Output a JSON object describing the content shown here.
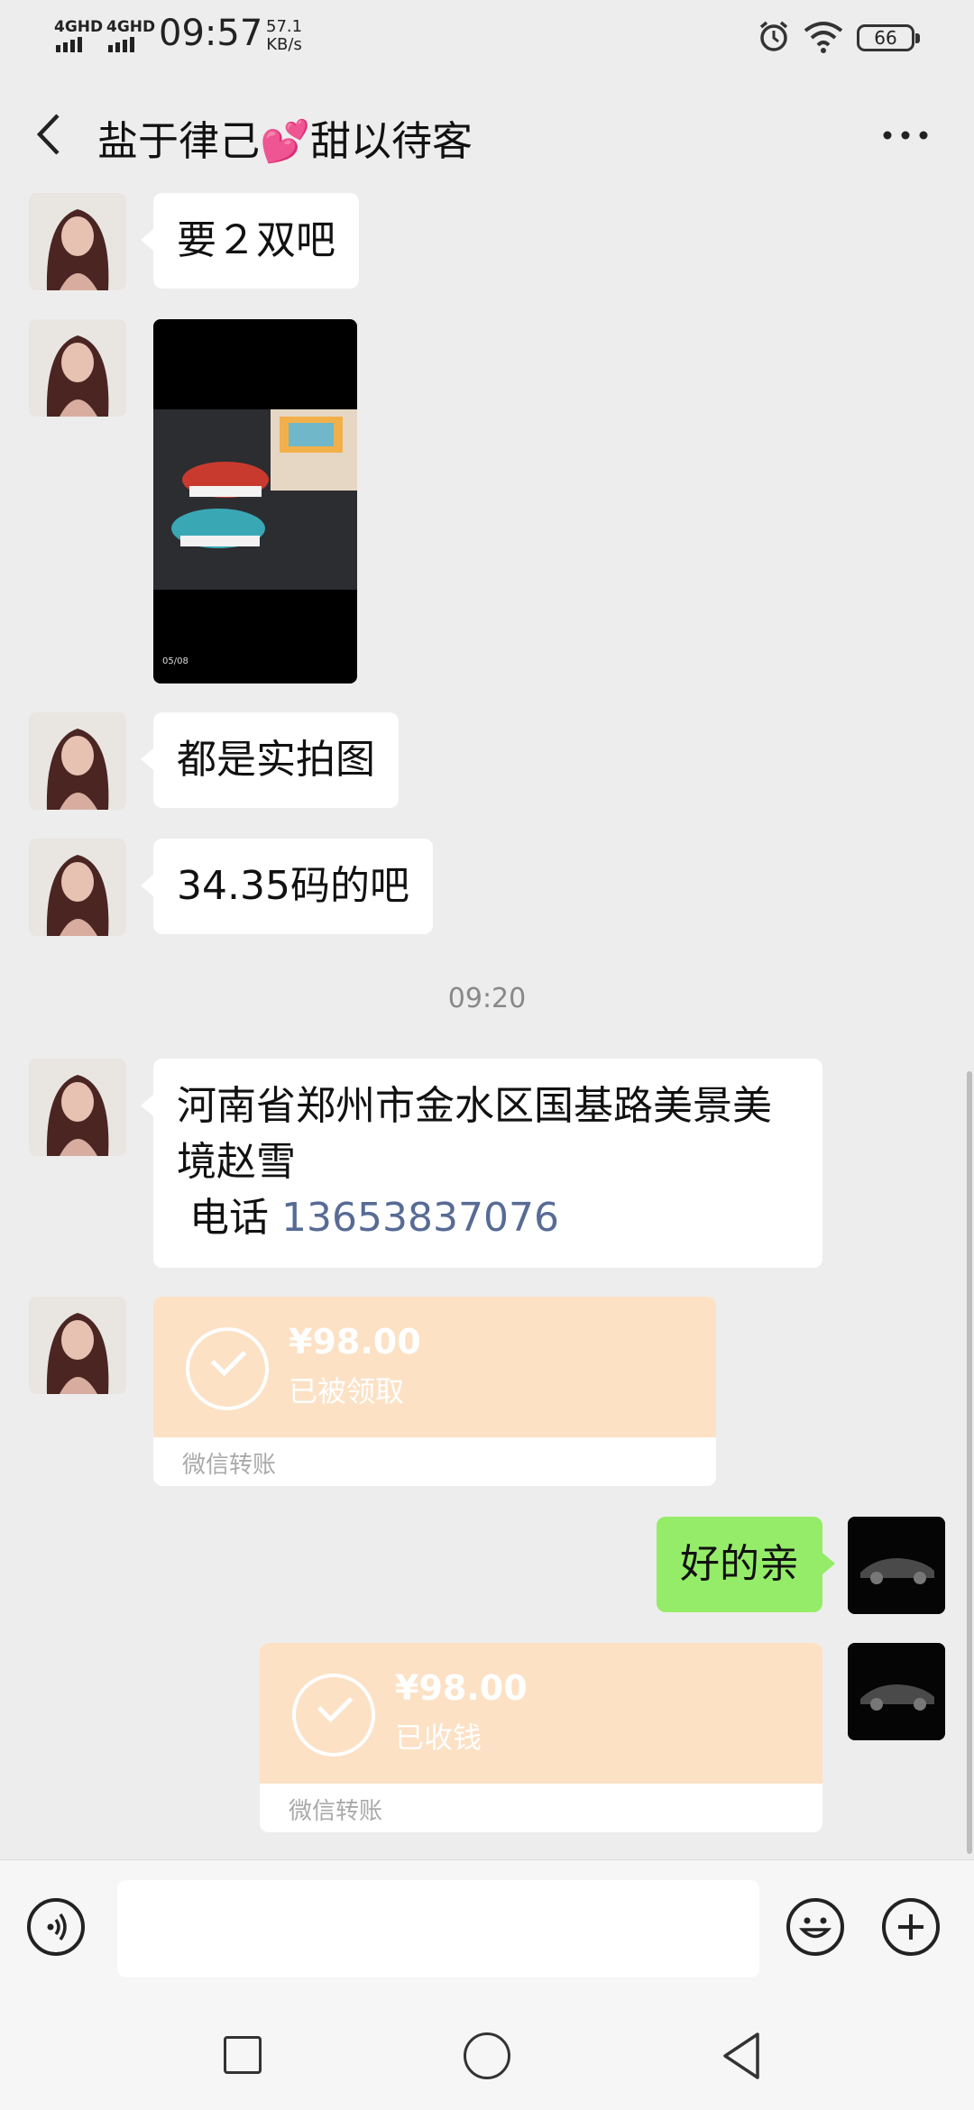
{
  "status_bar": {
    "signal_1": "4GHD",
    "signal_2": "4GHD",
    "time": "09:57",
    "speed_value": "57.1",
    "speed_unit": "KB/s",
    "battery": "66"
  },
  "header": {
    "title": "盐于律己💕甜以待客",
    "back_icon": "chevron-left-icon",
    "more_icon": "more-dots-icon"
  },
  "messages": {
    "m1": "要２双吧",
    "image_caption": "05/08",
    "m3": "都是实拍图",
    "m4": "34.35码的吧",
    "timestamp": "09:20",
    "address_line": "河南省郑州市金水区国基路美景美境赵雪",
    "phone_label": "电话",
    "phone_number": "13653837076",
    "transfer_1": {
      "amount": "¥98.00",
      "status": "已被领取",
      "footer": "微信转账"
    },
    "reply": "好的亲",
    "transfer_2": {
      "amount": "¥98.00",
      "status": "已收钱",
      "footer": "微信转账"
    }
  },
  "input_bar": {
    "voice_icon": "voice-icon",
    "emoji_icon": "emoji-icon",
    "plus_icon": "plus-icon",
    "text_value": ""
  },
  "nav_keys": [
    "recent-apps-icon",
    "home-icon",
    "back-triangle-icon"
  ],
  "colors": {
    "background": "#ededed",
    "my_bubble": "#95ec69",
    "transfer": "#fce1c5",
    "link": "#576b95"
  }
}
